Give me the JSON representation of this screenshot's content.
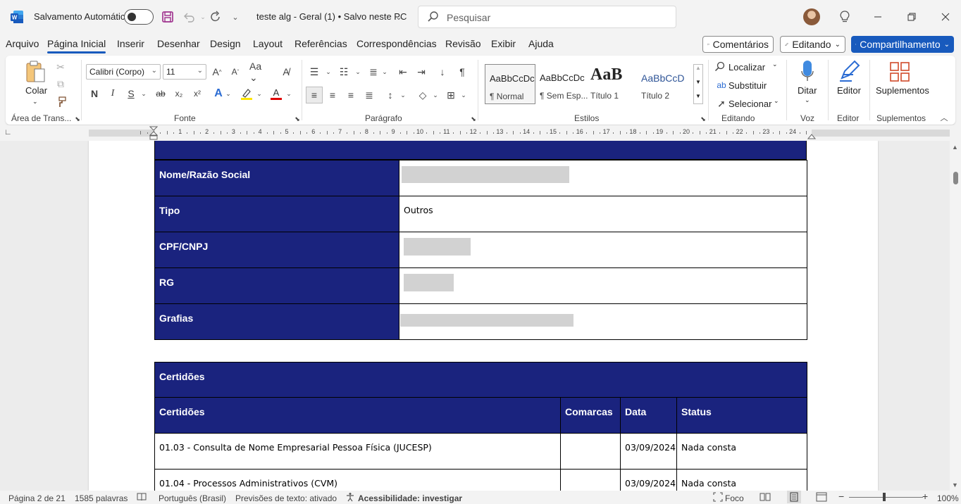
{
  "titlebar": {
    "autosave_label": "Salvamento Automático",
    "doc_title": "teste alg - Geral (1) • Salvo neste PC",
    "search_placeholder": "Pesquisar"
  },
  "menu": {
    "items": [
      "Arquivo",
      "Página Inicial",
      "Inserir",
      "Desenhar",
      "Design",
      "Layout",
      "Referências",
      "Correspondências",
      "Revisão",
      "Exibir",
      "Ajuda"
    ],
    "active_index": 1,
    "comments_label": "Comentários",
    "editing_label": "Editando",
    "share_label": "Compartilhamento"
  },
  "ribbon": {
    "paste_label": "Colar",
    "clipboard_group": "Área de Trans...",
    "font_name": "Calibri (Corpo)",
    "font_size": "11",
    "bold_label": "N",
    "italic_label": "I",
    "underline_label": "S",
    "font_group": "Fonte",
    "paragraph_group": "Parágrafo",
    "styles": [
      {
        "preview": "AaBbCcDc",
        "name": "¶ Normal"
      },
      {
        "preview": "AaBbCcDc",
        "name": "¶ Sem Esp..."
      },
      {
        "preview": "AaB",
        "name": "Título 1"
      },
      {
        "preview": "AaBbCcD",
        "name": "Título 2"
      }
    ],
    "styles_group": "Estilos",
    "find_label": "Localizar",
    "replace_label": "Substituir",
    "select_label": "Selecionar",
    "editing_group": "Editando",
    "dictate_label": "Ditar",
    "voice_group": "Voz",
    "editor_label": "Editor",
    "editor_group": "Editor",
    "addins_label": "Suplementos",
    "addins_group": "Suplementos"
  },
  "ruler": {
    "numbers": [
      "1",
      "2",
      "3",
      "4",
      "5",
      "6",
      "7",
      "8",
      "9",
      "10",
      "11",
      "12",
      "13",
      "14",
      "15",
      "16",
      "17",
      "18",
      "19",
      "20",
      "21",
      "22",
      "23",
      "24"
    ]
  },
  "document": {
    "info_table": [
      {
        "label": "Nome/Razão Social",
        "value": ""
      },
      {
        "label": "Tipo",
        "value": "Outros"
      },
      {
        "label": "CPF/CNPJ",
        "value": ""
      },
      {
        "label": "RG",
        "value": ""
      },
      {
        "label": "Grafias",
        "value": ""
      }
    ],
    "cert_title": "Certidões",
    "cert_headers": [
      "Certidões",
      "Comarcas",
      "Data",
      "Status"
    ],
    "cert_rows": [
      {
        "name": "01.03 - Consulta de Nome Empresarial Pessoa Física (JUCESP)",
        "comarca": "",
        "date": "03/09/2024",
        "status": "Nada consta"
      },
      {
        "name": "01.04 - Processos Administrativos (CVM)",
        "comarca": "",
        "date": "03/09/2024",
        "status": "Nada consta"
      }
    ]
  },
  "statusbar": {
    "page": "Página 2 de 21",
    "words": "1585 palavras",
    "language": "Português (Brasil)",
    "predictions": "Previsões de texto: ativado",
    "accessibility": "Acessibilidade: investigar",
    "focus": "Foco",
    "zoom": "100%"
  },
  "colors": {
    "accent": "#185abd",
    "table_header": "#1a237e"
  }
}
